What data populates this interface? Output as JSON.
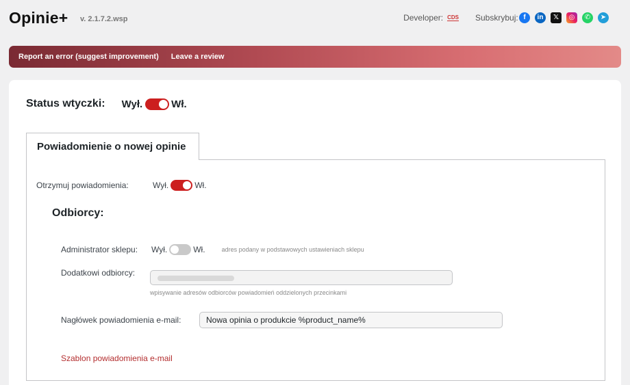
{
  "header": {
    "logo": "Opinie+",
    "version": "v. 2.1.7.2.wsp",
    "developer_label": "Developer:",
    "developer_logo": "CDS",
    "subscribe_label": "Subskrybuj:",
    "socials": [
      {
        "icon": "facebook-icon",
        "glyph": "f",
        "color": "#1877f2"
      },
      {
        "icon": "linkedin-icon",
        "glyph": "in",
        "color": "#0a66c2"
      },
      {
        "icon": "x-icon",
        "glyph": "𝕏",
        "color": "#111111"
      },
      {
        "icon": "instagram-icon",
        "glyph": "◎",
        "color": "#e1306c"
      },
      {
        "icon": "whatsapp-icon",
        "glyph": "✆",
        "color": "#25d366"
      },
      {
        "icon": "telegram-icon",
        "glyph": "➤",
        "color": "#229ed9"
      }
    ]
  },
  "banner": {
    "report_label": "Report an error (suggest improvement)",
    "review_label": "Leave a review"
  },
  "status": {
    "label": "Status wtyczki:",
    "off": "Wył.",
    "on": "Wł.",
    "enabled": true
  },
  "tab": {
    "title": "Powiadomienie o nowej opinie"
  },
  "notifications": {
    "label": "Otrzymuj powiadomienia:",
    "off": "Wył.",
    "on": "Wł.",
    "enabled": true
  },
  "recipients": {
    "heading": "Odbiorcy:",
    "admin_label": "Administrator sklepu:",
    "admin_off": "Wył.",
    "admin_on": "Wł.",
    "admin_enabled": false,
    "admin_hint": "adres podany w podstawowych ustawieniach sklepu",
    "extra_label": "Dodatkowi odbiorcy:",
    "extra_hint": "wpisywanie adresów odbiorców powiadomień oddzielonych przecinkami"
  },
  "email": {
    "header_label": "Nagłówek powiadomienia e-mail:",
    "header_value": "Nowa opinia o produkcie %product_name%",
    "template_link": "Szablon powiadomienia e-mail"
  },
  "colors": {
    "toggle_on": "#cc1f1f",
    "toggle_off": "#c9c9c9",
    "link": "#b32d2e"
  }
}
